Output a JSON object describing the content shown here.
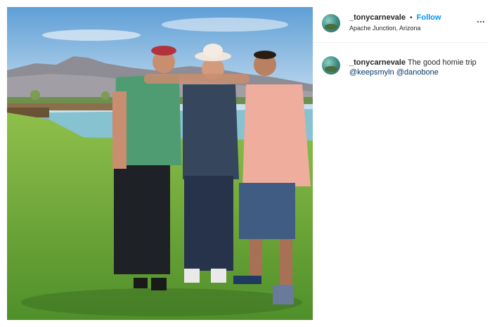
{
  "post": {
    "username": "_tonycarnevale",
    "follow_label": "Follow",
    "separator": "•",
    "location": "Apache Junction, Arizona",
    "more_icon": "more-options-icon"
  },
  "comment": {
    "username": "_tonycarnevale",
    "caption": "The good homie trip",
    "mentions": [
      "@keepsmyln",
      "@danobone"
    ]
  },
  "image": {
    "scene": "photo"
  },
  "colors": {
    "follow": "#0095f6",
    "mention": "#00376b",
    "divider": "#efefef"
  }
}
